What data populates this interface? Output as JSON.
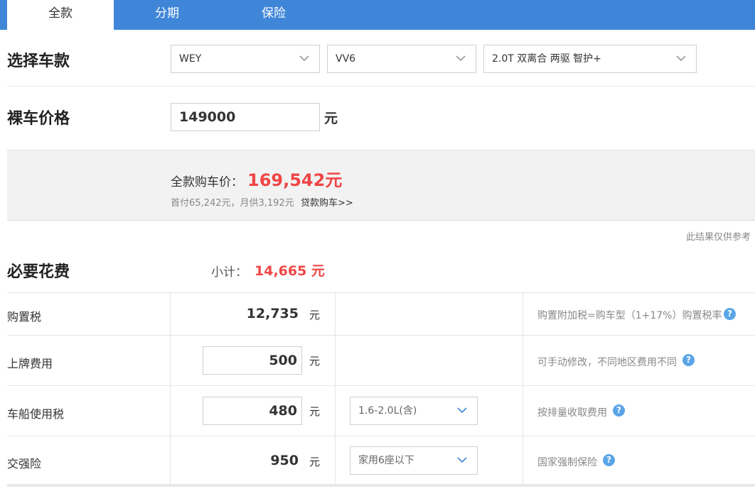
{
  "tabs": [
    {
      "label": "全款"
    },
    {
      "label": "分期"
    },
    {
      "label": "保险"
    }
  ],
  "select_model": {
    "title": "选择车款",
    "brand": "WEY",
    "series": "VV6",
    "trim": "2.0T 双离合 两驱 智护+"
  },
  "base_price": {
    "title": "裸车价格",
    "value": "149000",
    "unit": "元"
  },
  "summary": {
    "label": "全款购车价：",
    "total": "169,542元",
    "sub": "首付65,242元，月供3,192元",
    "loan_link": "贷款购车>>"
  },
  "note": "此结果仅供参考",
  "required": {
    "title": "必要花费",
    "subtotal_label": "小计：",
    "subtotal_value": "14,665 元",
    "rows": [
      {
        "label": "购置税",
        "value": "12,735",
        "unit": "元",
        "desc": "购置附加税=购车型（1+17%）购置税率"
      },
      {
        "label": "上牌费用",
        "value": "500",
        "unit": "元",
        "desc": "可手动修改，不同地区费用不同"
      },
      {
        "label": "车船使用税",
        "value": "480",
        "unit": "元",
        "option": "1.6-2.0L(含)",
        "desc": "按排量收取费用"
      },
      {
        "label": "交强险",
        "value": "950",
        "unit": "元",
        "option": "家用6座以下",
        "desc": "国家强制保险"
      }
    ]
  },
  "help_icon": "?",
  "colors": {
    "tab_bar": "#3f86d8",
    "accent_red": "#f04646",
    "help_icon": "#5aa5e8"
  }
}
